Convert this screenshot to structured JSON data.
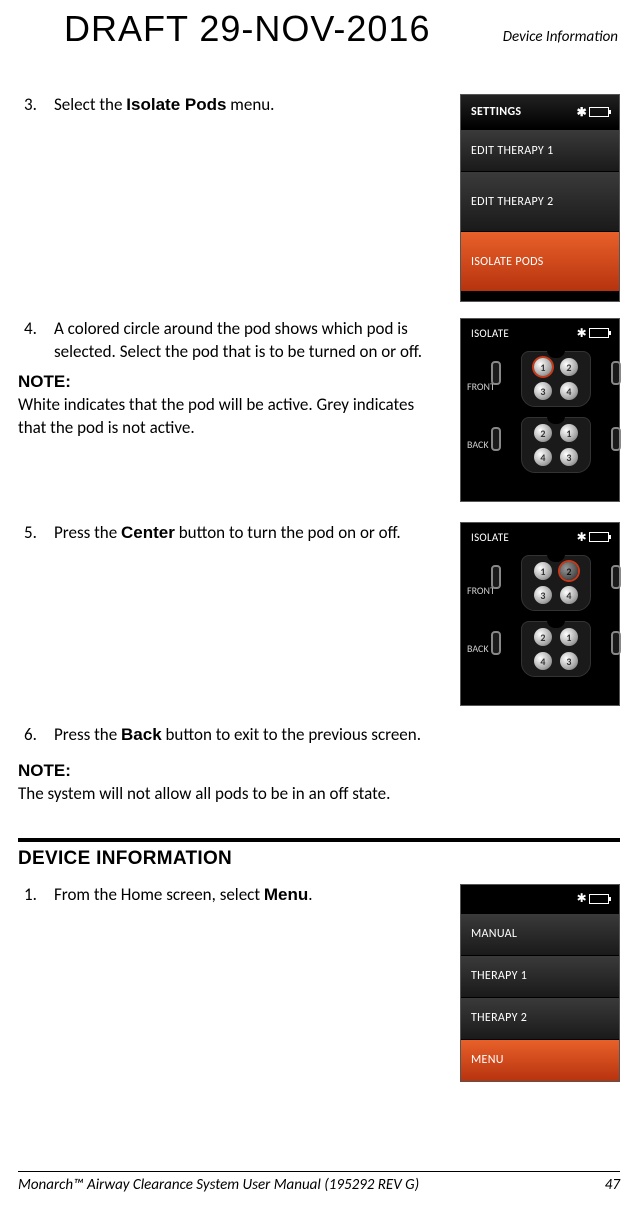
{
  "header": {
    "draft": "DRAFT 29-NOV-2016",
    "section": "Device Information"
  },
  "steps": {
    "s3": {
      "num": "3.",
      "pre": "Select the ",
      "bold": "Isolate Pods",
      "post": " menu."
    },
    "s4": {
      "num": "4.",
      "text": "A colored circle around the pod shows which pod is selected. Select the pod that is to be turned on or off."
    },
    "s5": {
      "num": "5.",
      "pre": "Press the ",
      "bold": "Center",
      "post": " button to turn the pod on or off."
    },
    "s6": {
      "num": "6.",
      "pre": "Press the ",
      "bold": "Back",
      "post": " button to exit to the previous screen."
    }
  },
  "notes": {
    "label": "NOTE:",
    "n1": "White indicates that the pod will be active. Grey indicates that the pod is not active.",
    "n2": "The system will not allow all pods to be in an off state."
  },
  "section2": {
    "title": "DEVICE INFORMATION",
    "s1": {
      "num": "1.",
      "pre": "From the Home screen, select ",
      "bold": "Menu",
      "post": "."
    }
  },
  "screens": {
    "settings": {
      "title": "SETTINGS",
      "items": [
        "EDIT THERAPY 1",
        "EDIT THERAPY 2",
        "ISOLATE PODS"
      ],
      "selected": 2
    },
    "isolate": {
      "title": "ISOLATE",
      "front": "FRONT",
      "back": "BACK",
      "pods_front": [
        "1",
        "2",
        "3",
        "4"
      ],
      "pods_back": [
        "2",
        "1",
        "4",
        "3"
      ]
    },
    "menu": {
      "items": [
        "MANUAL",
        "THERAPY 1",
        "THERAPY 2",
        "MENU"
      ],
      "selected": 3
    }
  },
  "footer": {
    "left": "Monarch™ Airway Clearance System User Manual (195292 REV G)",
    "right": "47"
  }
}
